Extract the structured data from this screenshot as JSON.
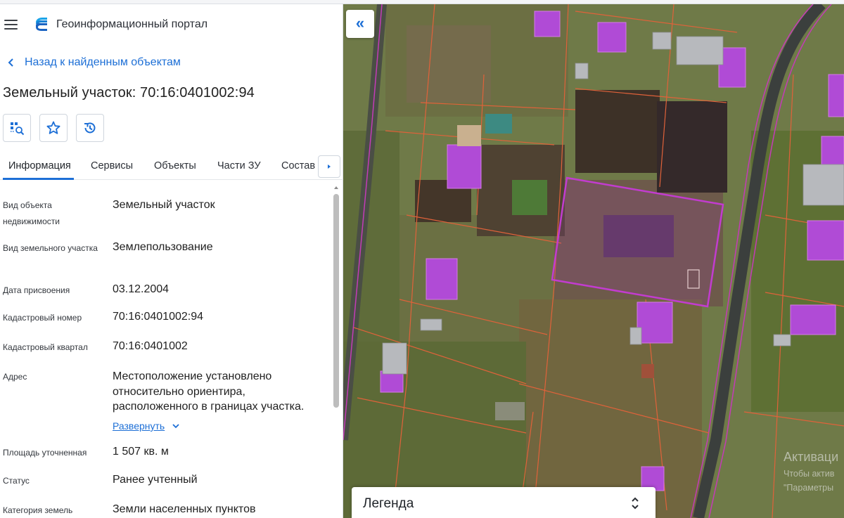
{
  "app": {
    "title": "Геоинформационный портал"
  },
  "navigation": {
    "back_label": "Назад к найденным объектам"
  },
  "object": {
    "title": "Земельный участок: 70:16:0401002:94"
  },
  "tabs": [
    {
      "label": "Информация",
      "active": true
    },
    {
      "label": "Сервисы",
      "active": false
    },
    {
      "label": "Объекты",
      "active": false
    },
    {
      "label": "Части ЗУ",
      "active": false
    },
    {
      "label": "Состав",
      "active": false
    }
  ],
  "properties": [
    {
      "label": "Вид объекта недвижимости",
      "value": "Земельный участок"
    },
    {
      "label": "Вид земельного участка",
      "value": "Землепользование"
    },
    {
      "label": "Дата присвоения",
      "value": "03.12.2004"
    },
    {
      "label": "Кадастровый номер",
      "value": "70:16:0401002:94"
    },
    {
      "label": "Кадастровый квартал",
      "value": "70:16:0401002"
    },
    {
      "label": "Адрес",
      "value": "Местоположение установлено относительно ориентира, расположенного в границах участка."
    },
    {
      "label": "Площадь уточненная",
      "value": "1 507 кв. м"
    },
    {
      "label": "Статус",
      "value": "Ранее учтенный"
    },
    {
      "label": "Категория земель",
      "value": "Земли населенных пунктов"
    }
  ],
  "address_expand_label": "Развернуть",
  "legend": {
    "title": "Легенда"
  },
  "watermark": {
    "line1": "Активаци",
    "line2": "Чтобы актив",
    "line3": "\"Параметры"
  },
  "icons": {
    "menu": "hamburger-icon",
    "logo": "portal-logo-icon",
    "back": "chevron-left-icon",
    "tool1": "map-search-icon",
    "tool2": "star-icon",
    "tool3": "history-icon",
    "tab_next": "triangle-right-icon",
    "collapse": "double-chevron-left-icon",
    "legend_toggle": "unfold-icon"
  },
  "colors": {
    "accent": "#1d6fd6",
    "parcel_border": "#e0623a",
    "building_fill": "#b04bd6",
    "selected_parcel": "#c23ccf"
  }
}
